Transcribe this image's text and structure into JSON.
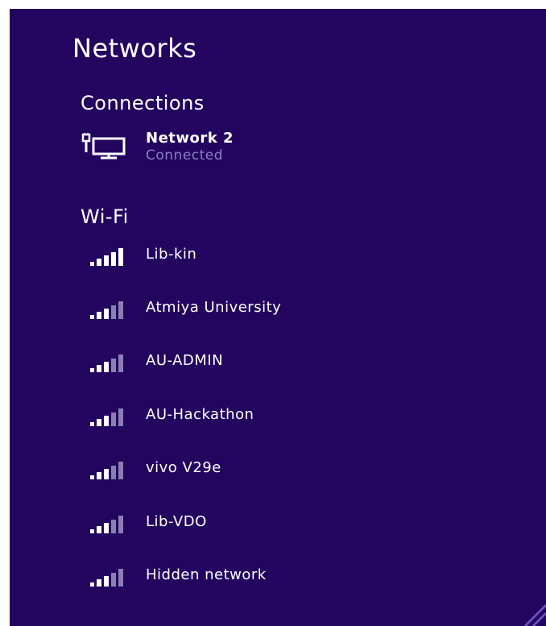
{
  "panel": {
    "title": "Networks"
  },
  "connections": {
    "heading": "Connections",
    "items": [
      {
        "name": "Network  2",
        "status": "Connected",
        "icon": "ethernet-monitor-icon"
      }
    ]
  },
  "wifi": {
    "heading": "Wi-Fi",
    "networks": [
      {
        "name": "Lib-kin",
        "signal_bars": 5
      },
      {
        "name": "Atmiya University",
        "signal_bars": 3
      },
      {
        "name": "AU-ADMIN",
        "signal_bars": 3
      },
      {
        "name": "AU-Hackathon",
        "signal_bars": 3
      },
      {
        "name": "vivo V29e",
        "signal_bars": 3
      },
      {
        "name": "Lib-VDO",
        "signal_bars": 3
      },
      {
        "name": "Hidden network",
        "signal_bars": 3
      }
    ]
  },
  "colors": {
    "background": "#230560",
    "text": "#ffffff",
    "status_text": "#8e7cc3",
    "inactive_bar": "#8a7fb4"
  }
}
